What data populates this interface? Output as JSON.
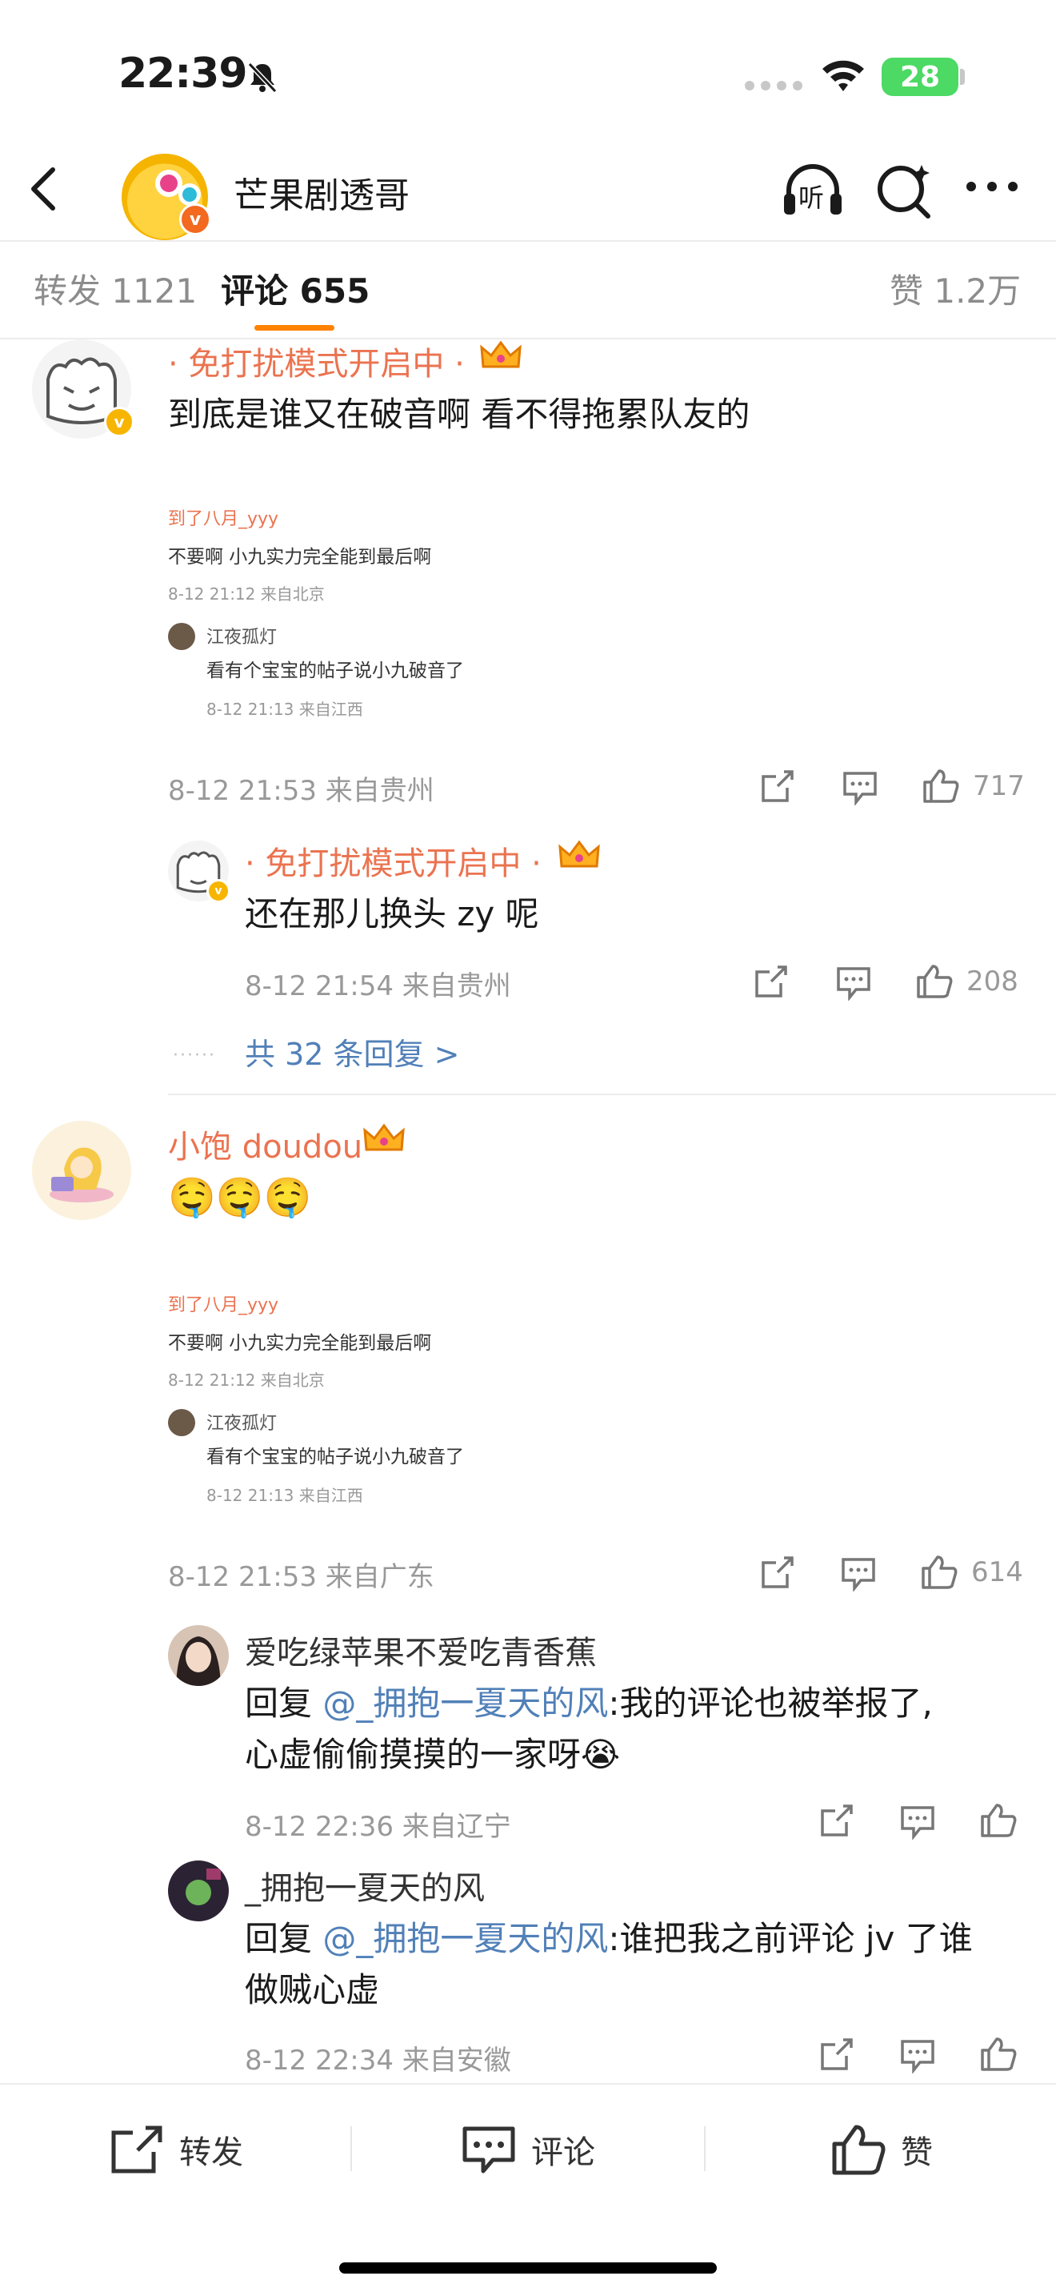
{
  "status_bar": {
    "time": "22:39",
    "battery": "28",
    "mute_icon": "bell-slash-icon"
  },
  "nav": {
    "title": "芒果剧透哥",
    "listen_label": "听"
  },
  "tabs": [
    {
      "label": "转发 1121",
      "selected": false
    },
    {
      "label": "评论 655",
      "selected": true
    },
    {
      "label": "赞 1.2万",
      "selected": false
    }
  ],
  "comments": [
    {
      "username": "· 免打扰模式开启中 ·",
      "text": "到底是谁又在破音啊 看不得拖累队友的",
      "embed": {
        "line1": "到了八月_yyy",
        "line2": "不要啊 小九实力完全能到最后啊",
        "line3": "8-12 21:12 来自北京",
        "reply_user": "江夜孤灯",
        "reply_text": "看有个宝宝的帖子说小九破音了",
        "reply_meta": "8-12 21:13 来自江西"
      },
      "meta": "8-12 21:53 来自贵州",
      "likes": "717",
      "replies": [
        {
          "username": "· 免打扰模式开启中 ·",
          "text": "还在那儿换头 zy 呢",
          "meta": "8-12 21:54 来自贵州",
          "likes": "208"
        }
      ],
      "more_replies": "共 32 条回复 >"
    },
    {
      "username": "小饱 doudou",
      "text": "🤤🤤🤤",
      "embed": {
        "line1": "到了八月_yyy",
        "line2": "不要啊 小九实力完全能到最后啊",
        "line3": "8-12 21:12 来自北京",
        "reply_user": "江夜孤灯",
        "reply_text": "看有个宝宝的帖子说小九破音了",
        "reply_meta": "8-12 21:13 来自江西"
      },
      "meta": "8-12 21:53 来自广东",
      "likes": "614",
      "replies": [
        {
          "username": "爱吃绿苹果不爱吃青香蕉",
          "reply_prefix": "回复 ",
          "mention": "@_拥抱一夏天的风",
          "text_line1": ":我的评论也被举报了,",
          "text_line2": "心虚偷偷摸摸的一家呀😭",
          "meta": "8-12 22:36 来自辽宁"
        },
        {
          "username": "_拥抱一夏天的风",
          "reply_prefix": "回复 ",
          "mention": "@_拥抱一夏天的风",
          "text_line1": ":谁把我之前评论 jv 了谁",
          "text_line2": "做贼心虚",
          "meta": "8-12 22:34 来自安徽"
        }
      ]
    }
  ],
  "bottom_bar": {
    "repost": "转发",
    "comment": "评论",
    "like": "赞"
  },
  "colors": {
    "accent": "#ff8200",
    "username_orange": "#eb7350",
    "mention_blue": "#5180b8",
    "meta_gray": "#999999"
  }
}
